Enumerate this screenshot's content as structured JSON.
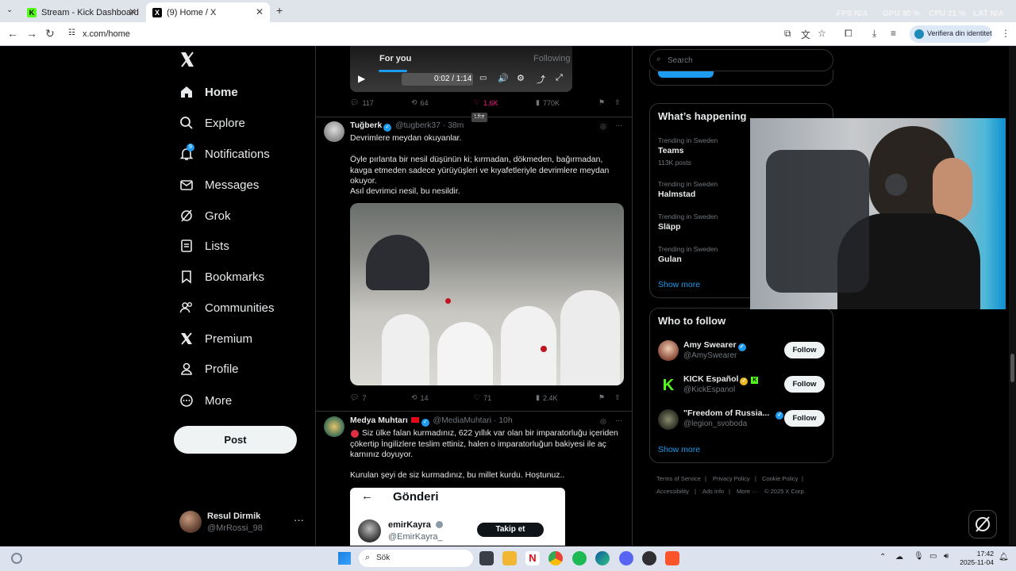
{
  "browser": {
    "tabs": [
      {
        "title": "Stream - Kick Dashboard",
        "active": false,
        "favicon": "kick-icon"
      },
      {
        "title": "(9) Home / X",
        "active": true,
        "favicon": "x-icon"
      }
    ],
    "url": "x.com/home",
    "identity_label": "Verifiera din identitet",
    "overlay_stats": [
      "FPS N/A",
      "GPU 30 %",
      "CPU 21 %",
      "LAT N/A"
    ]
  },
  "nav": {
    "items": [
      {
        "label": "Home",
        "icon": "home-icon"
      },
      {
        "label": "Explore",
        "icon": "search-icon"
      },
      {
        "label": "Notifications",
        "icon": "bell-icon",
        "badge": "9"
      },
      {
        "label": "Messages",
        "icon": "mail-icon"
      },
      {
        "label": "Grok",
        "icon": "grok-icon"
      },
      {
        "label": "Lists",
        "icon": "list-icon"
      },
      {
        "label": "Bookmarks",
        "icon": "bookmark-icon"
      },
      {
        "label": "Communities",
        "icon": "people-icon"
      },
      {
        "label": "Premium",
        "icon": "x-icon"
      },
      {
        "label": "Profile",
        "icon": "person-icon"
      },
      {
        "label": "More",
        "icon": "more-circle-icon"
      }
    ],
    "post_label": "Post",
    "account": {
      "name": "Resul Dirmik",
      "handle": "@MrRossi_98"
    }
  },
  "timeline": {
    "tabs": [
      "For you",
      "Following"
    ],
    "video": {
      "time": "0:02 / 1:14"
    },
    "first_actions": {
      "replies": "117",
      "reposts": "64",
      "likes": "1.6K",
      "views": "770K",
      "tooltip": "Like"
    },
    "tweet1": {
      "name": "Tuğberk",
      "handle": "@tugberk37",
      "time": "· 38m",
      "line1": "Devrimlere meydan okuyanlar.",
      "line2": "Öyle pırlanta bir nesil düşünün ki; kırmadan, dökmeden, bağırmadan, kavga etmeden sadece yürüyüşleri ve kıyafetleriyle devrimlere meydan okuyor.",
      "line3": "Asıl devrimci nesil, bu nesildir.",
      "replies": "7",
      "reposts": "14",
      "likes": "71",
      "views": "2.4K"
    },
    "tweet2": {
      "name": "Medya Muhtarı",
      "handle": "@MediaMuhtari",
      "time": "· 10h",
      "line1": "Siz ülke falan kurmadınız, 622 yıllık var olan bir imparatorluğu içeriden çökertip İngilizlere teslim ettiniz, halen o imparatorluğun bakiyesi ile aç karnınız doyuyor.",
      "line2": "Kurulan şeyi de siz kurmadınız, bu millet kurdu. Hoştunuz..",
      "quoted": {
        "header": "Gönderi",
        "name": "emirKayra",
        "handle": "@EmirKayra_",
        "button": "Takip et"
      }
    }
  },
  "right": {
    "search_placeholder": "Search",
    "happening_title": "What’s happening",
    "trends": [
      {
        "meta": "Trending in Sweden",
        "name": "Teams",
        "posts": "113K posts"
      },
      {
        "meta": "Trending in Sweden",
        "name": "Halmstad"
      },
      {
        "meta": "Trending in Sweden",
        "name": "Släpp"
      },
      {
        "meta": "Trending in Sweden",
        "name": "Gulan"
      }
    ],
    "show_more": "Show more",
    "wtf_title": "Who to follow",
    "wtf": [
      {
        "name": "Amy Swearer",
        "handle": "@AmySwearer",
        "button": "Follow"
      },
      {
        "name": "KICK Español",
        "handle": "@KickEspanol",
        "button": "Follow"
      },
      {
        "name": "\"Freedom of Russia...",
        "handle": "@legion_svoboda",
        "button": "Follow"
      }
    ],
    "footer": [
      "Terms of Service",
      "Privacy Policy",
      "Cookie Policy",
      "Accessibility",
      "Ads info",
      "More ···",
      "© 2025 X Corp."
    ]
  },
  "taskbar": {
    "search_placeholder": "Sök",
    "time": "17:42",
    "date": "2025-11-04"
  }
}
